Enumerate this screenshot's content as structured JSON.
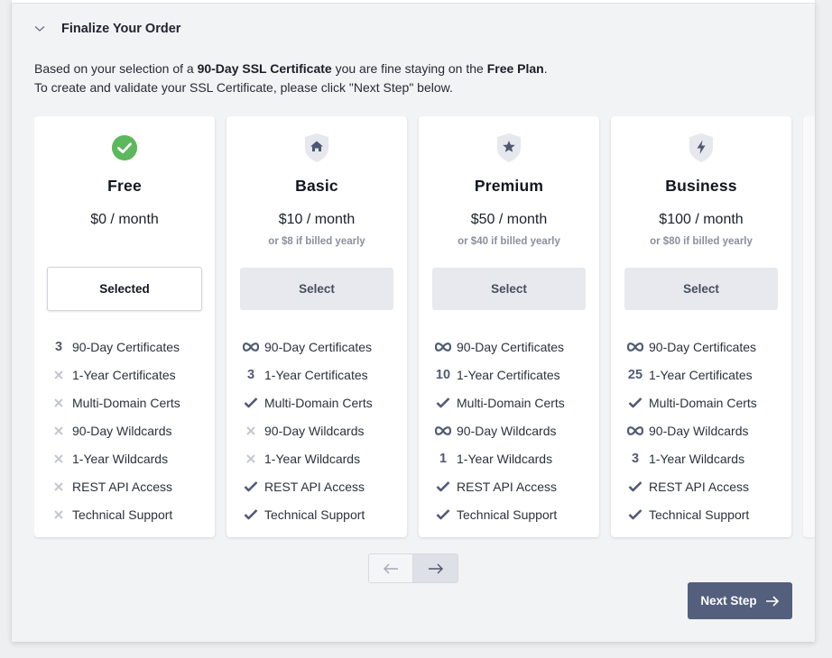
{
  "section": {
    "title": "Finalize Your Order",
    "expanded": true
  },
  "intro": {
    "line1_prefix": "Based on your selection of a ",
    "line1_bold1": "90-Day SSL Certificate",
    "line1_middle": " you are fine staying on the ",
    "line1_bold2": "Free Plan",
    "line1_suffix": ".",
    "line2": "To create and validate your SSL Certificate, please click \"Next Step\" below."
  },
  "colors": {
    "accent": "#545f7d",
    "success": "#5cb85c",
    "shield_bg": "#e6e8ee",
    "muted_x": "#c4c7cd"
  },
  "plans": [
    {
      "name": "Free",
      "icon": "check-circle-icon",
      "price": "$0 / month",
      "yearly": "",
      "button_label": "Selected",
      "selected": true,
      "features": [
        {
          "mark": "3",
          "type": "number",
          "label": "90-Day Certificates"
        },
        {
          "mark": "x",
          "type": "no",
          "label": "1-Year Certificates"
        },
        {
          "mark": "x",
          "type": "no",
          "label": "Multi-Domain Certs"
        },
        {
          "mark": "x",
          "type": "no",
          "label": "90-Day Wildcards"
        },
        {
          "mark": "x",
          "type": "no",
          "label": "1-Year Wildcards"
        },
        {
          "mark": "x",
          "type": "no",
          "label": "REST API Access"
        },
        {
          "mark": "x",
          "type": "no",
          "label": "Technical Support"
        }
      ]
    },
    {
      "name": "Basic",
      "icon": "home-shield-icon",
      "price": "$10 / month",
      "yearly": "or $8 if billed yearly",
      "button_label": "Select",
      "selected": false,
      "features": [
        {
          "mark": "∞",
          "type": "infinite",
          "label": "90-Day Certificates"
        },
        {
          "mark": "3",
          "type": "number",
          "label": "1-Year Certificates"
        },
        {
          "mark": "✓",
          "type": "yes",
          "label": "Multi-Domain Certs"
        },
        {
          "mark": "x",
          "type": "no",
          "label": "90-Day Wildcards"
        },
        {
          "mark": "x",
          "type": "no",
          "label": "1-Year Wildcards"
        },
        {
          "mark": "✓",
          "type": "yes",
          "label": "REST API Access"
        },
        {
          "mark": "✓",
          "type": "yes",
          "label": "Technical Support"
        }
      ]
    },
    {
      "name": "Premium",
      "icon": "star-shield-icon",
      "price": "$50 / month",
      "yearly": "or $40 if billed yearly",
      "button_label": "Select",
      "selected": false,
      "features": [
        {
          "mark": "∞",
          "type": "infinite",
          "label": "90-Day Certificates"
        },
        {
          "mark": "10",
          "type": "number",
          "label": "1-Year Certificates"
        },
        {
          "mark": "✓",
          "type": "yes",
          "label": "Multi-Domain Certs"
        },
        {
          "mark": "∞",
          "type": "infinite",
          "label": "90-Day Wildcards"
        },
        {
          "mark": "1",
          "type": "number",
          "label": "1-Year Wildcards"
        },
        {
          "mark": "✓",
          "type": "yes",
          "label": "REST API Access"
        },
        {
          "mark": "✓",
          "type": "yes",
          "label": "Technical Support"
        }
      ]
    },
    {
      "name": "Business",
      "icon": "bolt-shield-icon",
      "price": "$100 / month",
      "yearly": "or $80 if billed yearly",
      "button_label": "Select",
      "selected": false,
      "features": [
        {
          "mark": "∞",
          "type": "infinite",
          "label": "90-Day Certificates"
        },
        {
          "mark": "25",
          "type": "number",
          "label": "1-Year Certificates"
        },
        {
          "mark": "✓",
          "type": "yes",
          "label": "Multi-Domain Certs"
        },
        {
          "mark": "∞",
          "type": "infinite",
          "label": "90-Day Wildcards"
        },
        {
          "mark": "3",
          "type": "number",
          "label": "1-Year Wildcards"
        },
        {
          "mark": "✓",
          "type": "yes",
          "label": "REST API Access"
        },
        {
          "mark": "✓",
          "type": "yes",
          "label": "Technical Support"
        }
      ]
    }
  ],
  "pager": {
    "prev_icon": "arrow-left-icon",
    "next_icon": "arrow-right-icon",
    "prev_disabled": true
  },
  "next_step": {
    "label": "Next Step",
    "icon": "arrow-right-icon"
  }
}
